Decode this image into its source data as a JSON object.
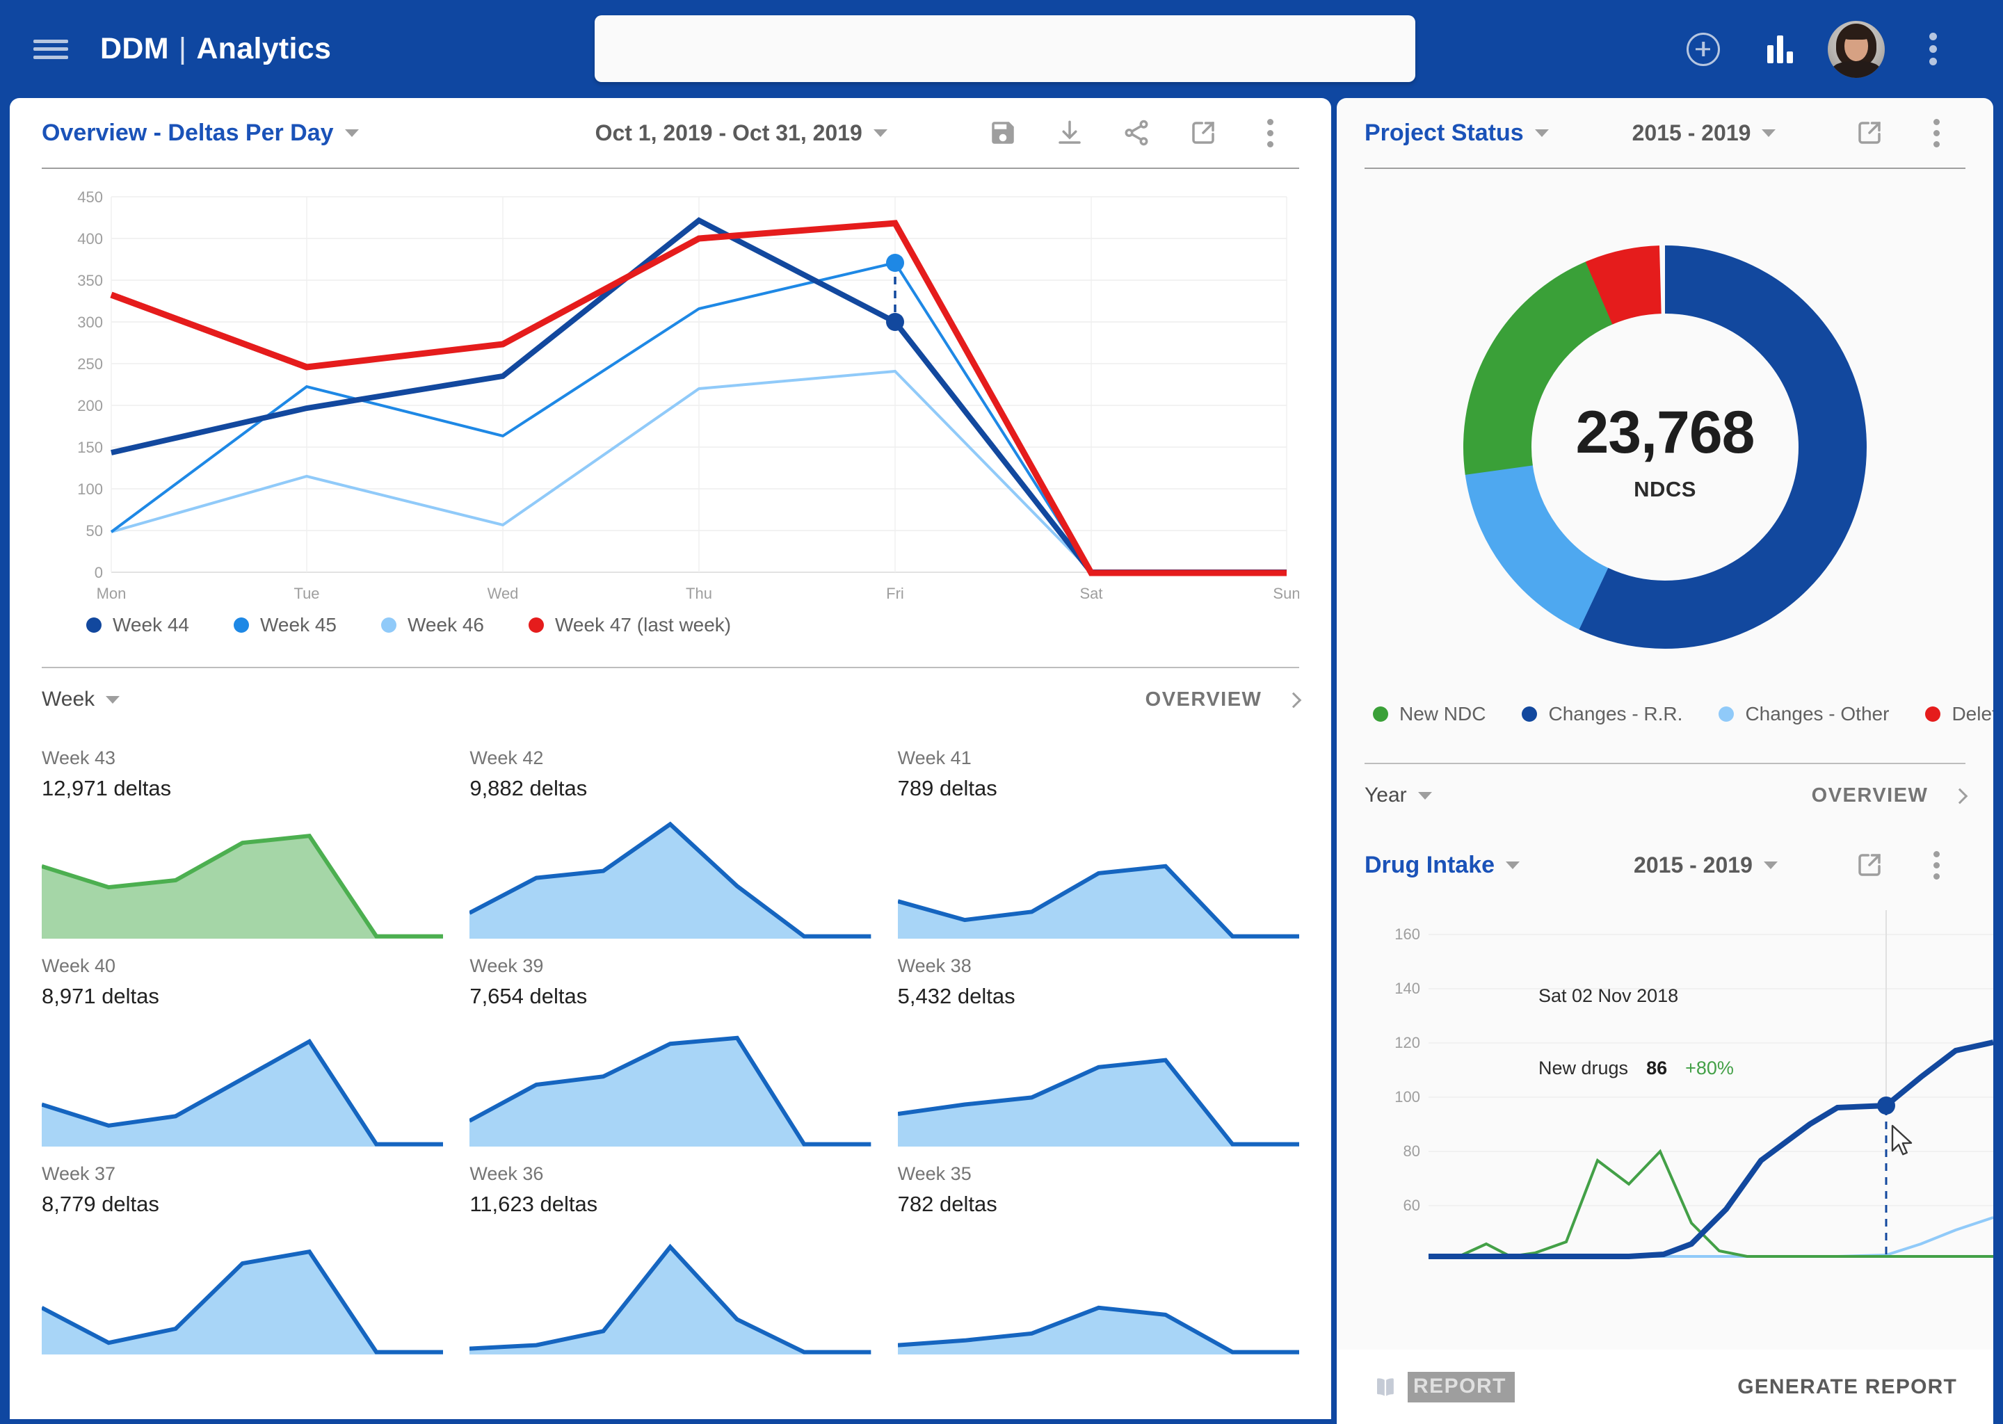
{
  "topbar": {
    "brand": "DDM",
    "separator": "|",
    "brand_sub": "Analytics",
    "search_value": "",
    "search_placeholder": "",
    "icons": [
      "add-circle-icon",
      "bar-chart-icon",
      "avatar",
      "more-vert-icon"
    ]
  },
  "overview_card": {
    "title": "Overview - Deltas Per Day",
    "date_range": "Oct 1, 2019 - Oct 31, 2019",
    "actions": [
      "save-icon",
      "download-icon",
      "share-icon",
      "open-external-icon",
      "more-vert-icon"
    ]
  },
  "chart_data": [
    {
      "type": "line",
      "title": "Overview - Deltas Per Day",
      "xlabel": "",
      "ylabel": "",
      "categories": [
        "Mon",
        "Tue",
        "Wed",
        "Thu",
        "Fri",
        "Sat",
        "Sun"
      ],
      "ylim": [
        0,
        450
      ],
      "yticks": [
        0,
        50,
        100,
        150,
        200,
        250,
        300,
        350,
        400,
        450
      ],
      "grid": true,
      "legend_position": "bottom",
      "series": [
        {
          "name": "Week 44",
          "color": "#12489e",
          "width": 6,
          "values": [
            143,
            197,
            235,
            422,
            300,
            1,
            1
          ]
        },
        {
          "name": "Week 45",
          "color": "#1e88e5",
          "width": 3,
          "values": [
            48,
            222,
            163,
            316,
            371,
            1,
            1
          ]
        },
        {
          "name": "Week 46",
          "color": "#90caf9",
          "width": 3,
          "values": [
            48,
            115,
            57,
            220,
            241,
            1,
            1
          ]
        },
        {
          "name": "Week 47 (last week)",
          "color": "#e51c1c",
          "width": 7,
          "values": [
            333,
            246,
            274,
            400,
            418,
            0,
            0
          ]
        }
      ],
      "markers": [
        {
          "series": "Week 45",
          "x": "Fri",
          "y": 371
        },
        {
          "series": "Week 44",
          "x": "Fri",
          "y": 300
        }
      ]
    },
    {
      "type": "pie",
      "subtype": "donut",
      "title": "Project Status",
      "center_value": "23,768",
      "center_label": "NDCS",
      "labels": [
        "Changes - R.R.",
        "Changes - Other",
        "New NDC",
        "Deleted"
      ],
      "values": [
        57,
        16,
        21,
        6
      ],
      "colors": [
        "#12489e",
        "#4ea8f0",
        "#3aa038",
        "#e51c1c"
      ],
      "legend_position": "bottom"
    },
    {
      "type": "line",
      "title": "Drug Intake",
      "ylim": [
        40,
        170
      ],
      "yticks": [
        60,
        80,
        100,
        120,
        140,
        160
      ],
      "grid": true,
      "series": [
        {
          "name": "new-drugs",
          "color": "#12489e",
          "width": 7,
          "values": [
            40,
            40,
            40,
            40,
            40,
            40,
            40,
            42,
            52,
            70,
            93,
            98,
            110,
            119,
            122
          ]
        },
        {
          "name": "green-series",
          "color": "#43a047",
          "width": 3,
          "values": [
            40,
            41,
            47,
            40,
            43,
            50,
            79,
            71,
            82,
            53,
            41,
            40,
            40,
            40,
            40
          ]
        },
        {
          "name": "light-series",
          "color": "#90caf9",
          "width": 3,
          "values": [
            40,
            40,
            40,
            40,
            40,
            40,
            40,
            40,
            40,
            40,
            41,
            44,
            50,
            57,
            62
          ]
        }
      ],
      "tooltip": {
        "date": "Sat 02 Nov 2018",
        "metric": "New drugs",
        "value": "86",
        "change": "+80%"
      }
    }
  ],
  "chart_legend": {
    "items": [
      {
        "label": "Week 44",
        "color": "#12489e"
      },
      {
        "label": "Week 45",
        "color": "#1e88e5"
      },
      {
        "label": "Week 46",
        "color": "#90caf9"
      },
      {
        "label": "Week 47 (last week)",
        "color": "#e51c1c"
      }
    ]
  },
  "week_section": {
    "group_by": "Week",
    "overview_label": "OVERVIEW",
    "cards": [
      {
        "week": "Week 43",
        "deltas": "12,971 deltas",
        "highlight": true,
        "points": [
          62,
          44,
          50,
          82,
          88,
          2,
          2
        ]
      },
      {
        "week": "Week 42",
        "deltas": "9,882 deltas",
        "highlight": false,
        "points": [
          22,
          52,
          58,
          98,
          45,
          2,
          2
        ]
      },
      {
        "week": "Week 41",
        "deltas": "789 deltas",
        "highlight": false,
        "points": [
          32,
          16,
          23,
          56,
          62,
          2,
          2
        ]
      },
      {
        "week": "Week 40",
        "deltas": "8,971 deltas",
        "highlight": false,
        "points": [
          36,
          18,
          26,
          58,
          90,
          2,
          2
        ]
      },
      {
        "week": "Week 39",
        "deltas": "7,654 deltas",
        "highlight": false,
        "points": [
          22,
          53,
          60,
          88,
          93,
          2,
          2
        ]
      },
      {
        "week": "Week 38",
        "deltas": "5,432 deltas",
        "highlight": false,
        "points": [
          28,
          36,
          42,
          68,
          74,
          2,
          2
        ]
      },
      {
        "week": "Week 37",
        "deltas": "8,779 deltas",
        "highlight": false,
        "points": [
          40,
          10,
          22,
          78,
          88,
          2,
          2
        ]
      },
      {
        "week": "Week 36",
        "deltas": "11,623 deltas",
        "highlight": false,
        "points": [
          5,
          8,
          20,
          92,
          30,
          2,
          2
        ]
      },
      {
        "week": "Week 35",
        "deltas": "782 deltas",
        "highlight": false,
        "points": [
          8,
          12,
          18,
          40,
          34,
          2,
          2
        ]
      }
    ]
  },
  "project_status_card": {
    "title": "Project Status",
    "year_range": "2015 - 2019",
    "actions": [
      "open-external-icon",
      "more-vert-icon"
    ],
    "legend": [
      {
        "label": "New NDC",
        "color": "#3aa038"
      },
      {
        "label": "Changes - R.R.",
        "color": "#12489e"
      },
      {
        "label": "Changes - Other",
        "color": "#90caf9"
      },
      {
        "label": "Deleted",
        "color": "#e51c1c"
      }
    ],
    "center_value": "23,768",
    "center_label": "NDCS"
  },
  "year_section": {
    "group_by": "Year",
    "overview_label": "OVERVIEW"
  },
  "drug_intake_card": {
    "title": "Drug Intake",
    "year_range": "2015 - 2019",
    "actions": [
      "open-external-icon",
      "more-vert-icon"
    ],
    "yticks": [
      "160",
      "140",
      "120",
      "100",
      "80",
      "60"
    ],
    "tooltip_date": "Sat 02 Nov 2018",
    "tooltip_metric": "New drugs",
    "tooltip_value": "86",
    "tooltip_change": "+80%"
  },
  "footer": {
    "report_label": "REPORT",
    "generate_label": "GENERATE REPORT"
  },
  "colors": {
    "brand_blue": "#0f47a1",
    "title_blue": "#1a52b8",
    "dark_blue": "#12489e",
    "mid_blue": "#1e88e5",
    "light_blue": "#90caf9",
    "red": "#e51c1c",
    "green": "#3aa038"
  }
}
